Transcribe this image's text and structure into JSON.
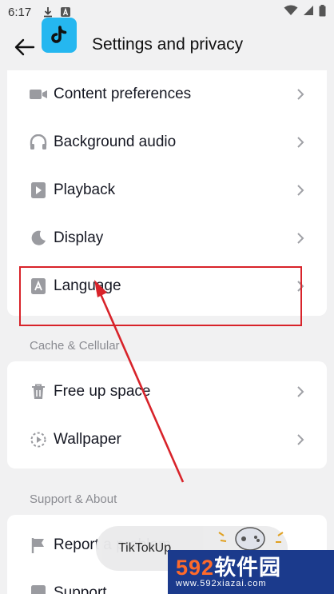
{
  "status_bar": {
    "time": "6:17"
  },
  "header": {
    "title": "Settings and privacy"
  },
  "section_general": {
    "items": [
      {
        "label": "Content preferences",
        "icon": "video-camera-icon"
      },
      {
        "label": "Background audio",
        "icon": "headphones-icon"
      },
      {
        "label": "Playback",
        "icon": "play-icon"
      },
      {
        "label": "Display",
        "icon": "moon-icon"
      },
      {
        "label": "Language",
        "icon": "language-icon"
      }
    ]
  },
  "section_cache": {
    "title": "Cache & Cellular",
    "items": [
      {
        "label": "Free up space",
        "icon": "trash-icon"
      },
      {
        "label": "Wallpaper",
        "icon": "wallpaper-icon"
      }
    ]
  },
  "section_support": {
    "title": "Support & About",
    "items": [
      {
        "label": "Report a problem",
        "icon": "flag-icon"
      },
      {
        "label": "Support",
        "icon": "support-icon"
      }
    ]
  },
  "toast": {
    "text": "TikTokUp"
  },
  "watermark": {
    "brand_num": "592",
    "brand_text": "软件园",
    "url": "www.592xiazai.com"
  },
  "colors": {
    "accent": "#25b7f0",
    "highlight": "#d8232a",
    "background": "#f1f1f2"
  }
}
